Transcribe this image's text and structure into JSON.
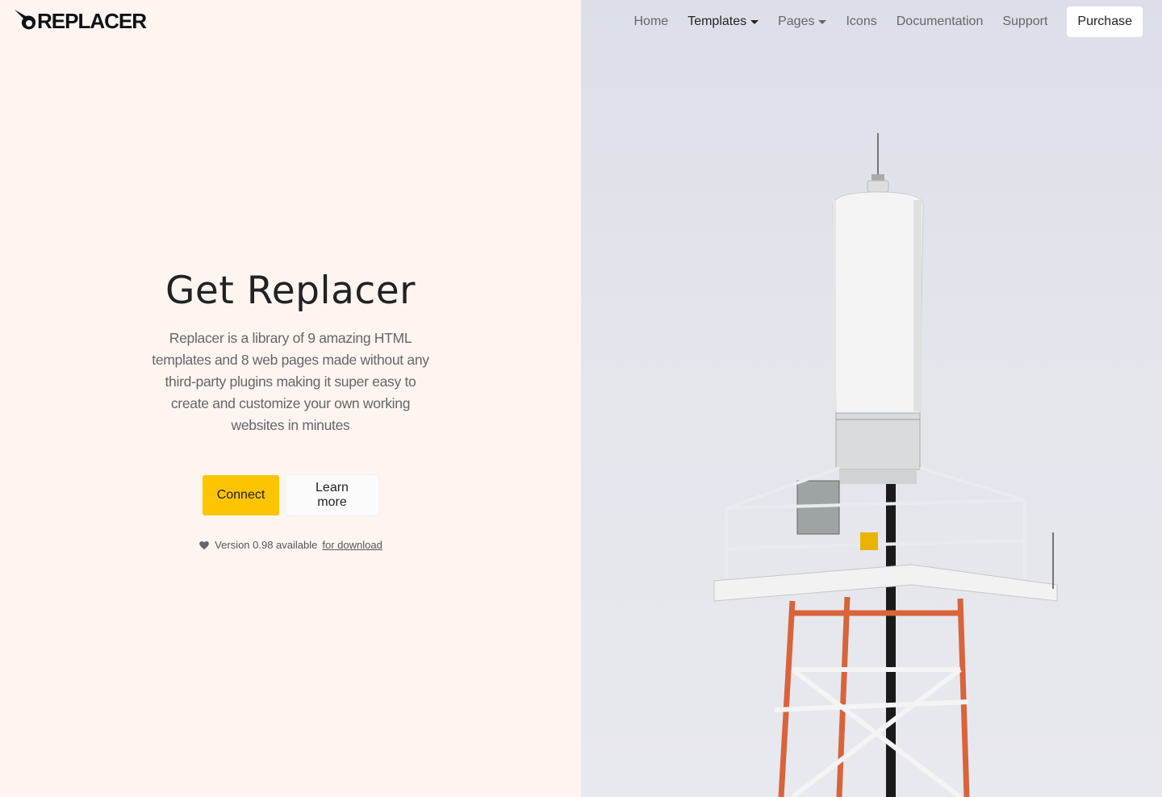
{
  "brand": {
    "name": "REPLACER",
    "logo_icon": "bird-icon"
  },
  "nav": {
    "items": [
      {
        "label": "Home",
        "dropdown": false,
        "active": false
      },
      {
        "label": "Templates",
        "dropdown": true,
        "active": true
      },
      {
        "label": "Pages",
        "dropdown": true,
        "active": false
      },
      {
        "label": "Icons",
        "dropdown": false,
        "active": false
      },
      {
        "label": "Documentation",
        "dropdown": false,
        "active": false
      },
      {
        "label": "Support",
        "dropdown": false,
        "active": false
      }
    ],
    "purchase_label": "Purchase"
  },
  "hero": {
    "title": "Get Replacer",
    "description": "Replacer is a library of 9 amazing HTML templates and 8 web pages made without any third-party plugins making it super easy to create and customize your own working websites in minutes",
    "primary_button": "Connect",
    "secondary_button": "Learn more",
    "version_text": "Version 0.98 available",
    "download_link": "for download"
  },
  "colors": {
    "accent": "#fdc400",
    "left_bg": "#fef5f1",
    "right_bg": "#e3e5ec"
  }
}
